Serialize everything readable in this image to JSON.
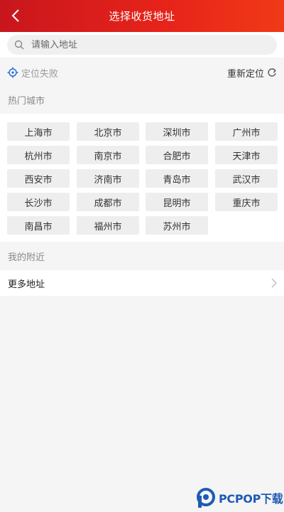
{
  "header": {
    "title": "选择收货地址"
  },
  "search": {
    "placeholder": "请输入地址"
  },
  "location": {
    "status": "定位失败",
    "relocate_label": "重新定位"
  },
  "hot_cities": {
    "title": "热门城市",
    "items": [
      "上海市",
      "北京市",
      "深圳市",
      "广州市",
      "杭州市",
      "南京市",
      "合肥市",
      "天津市",
      "西安市",
      "济南市",
      "青岛市",
      "武汉市",
      "长沙市",
      "成都市",
      "昆明市",
      "重庆市",
      "南昌市",
      "福州市",
      "苏州市"
    ]
  },
  "nearby": {
    "title": "我的附近",
    "more_label": "更多地址"
  },
  "watermark": {
    "brand": "PCPOP下载"
  },
  "colors": {
    "header_start": "#c8161d",
    "header_end": "#f03a17",
    "locate_icon": "#2c6fd8"
  }
}
